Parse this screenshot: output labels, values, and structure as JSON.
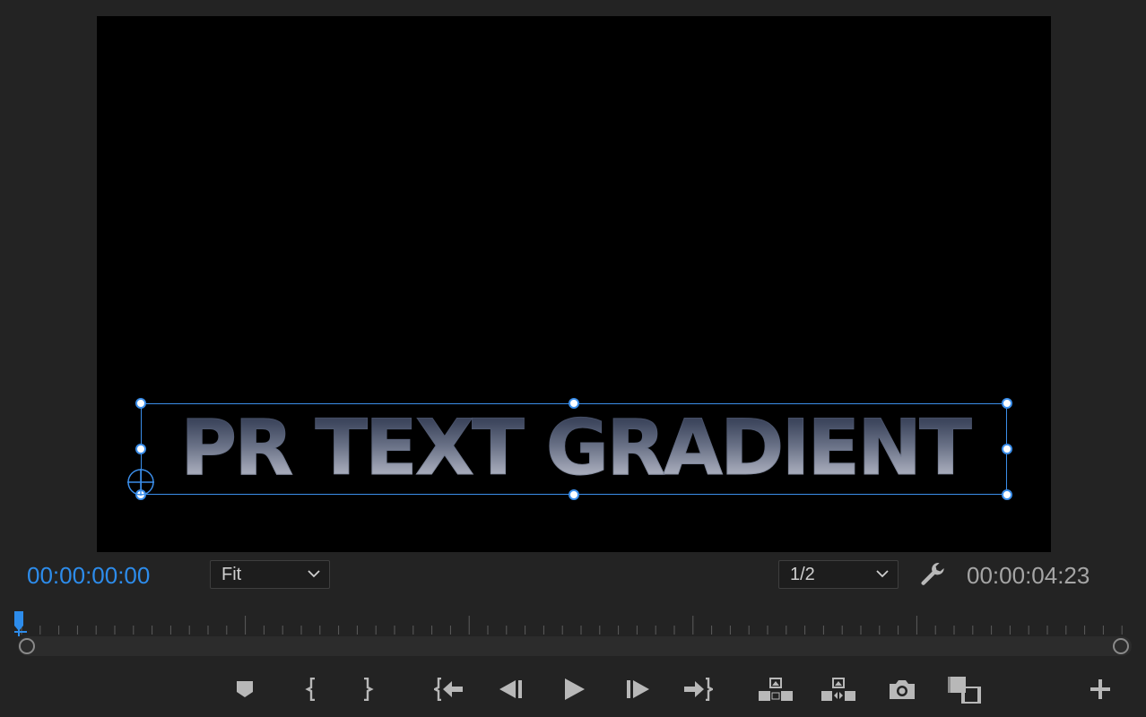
{
  "program_monitor": {
    "title_text": "PR TEXT GRADIENT",
    "current_time": "00:00:00:00",
    "duration": "00:00:04:23",
    "zoom": {
      "selected": "Fit"
    },
    "playback_resolution": {
      "selected": "1/2"
    }
  },
  "colors": {
    "accent": "#2d8ceb",
    "selection": "#3b8eea",
    "panel_bg": "#232323",
    "icon": "#b8b8b8"
  },
  "icons": {
    "settings": "wrench-icon",
    "controls": [
      "add-marker-icon",
      "mark-in-icon",
      "mark-out-icon",
      "go-to-in-icon",
      "step-back-icon",
      "play-icon",
      "step-forward-icon",
      "go-to-out-icon",
      "lift-icon",
      "extract-icon",
      "export-frame-icon",
      "comparison-view-icon",
      "button-editor-icon"
    ]
  }
}
